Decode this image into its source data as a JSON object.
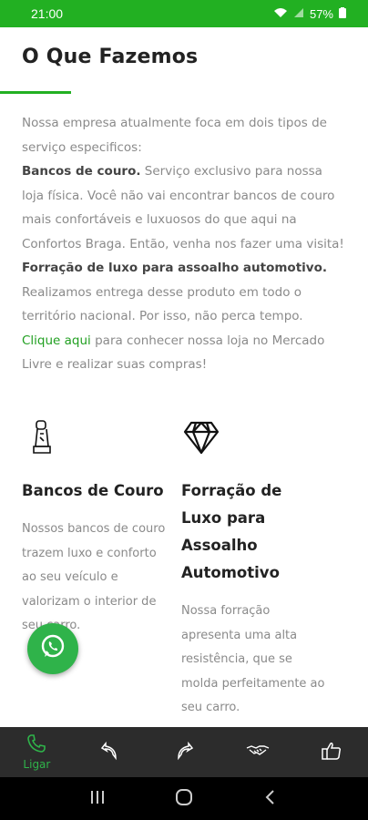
{
  "status": {
    "time": "21:00",
    "battery": "57%"
  },
  "section": {
    "title": "O Que Fazemos"
  },
  "intro": {
    "line1": "Nossa empresa atualmente foca em dois tipos de serviço especificos:",
    "item1_bold": "Bancos de couro.",
    "item1_text": " Serviço exclusivo para nossa loja física. Você não vai encontrar bancos de couro mais confortáveis e luxuosos do que aqui na Confortos Braga. Então, venha nos fazer uma visita!",
    "item2_bold": "Forração de luxo para assoalho automotivo.",
    "item2_text": " Realizamos entrega desse produto em todo o território nacional. Por isso, não perca tempo.",
    "link": "Clique aqui",
    "link_after": " para conhecer nossa loja no Mercado Livre e realizar suas compras!"
  },
  "services": [
    {
      "title": "Bancos de Couro",
      "text": "Nossos bancos de couro trazem luxo e conforto ao seu veículo e valorizam o interior de seu carro.",
      "icon": "seat-icon"
    },
    {
      "title": "Forração de Luxo para Assoalho Automotivo",
      "text": "Nossa forração apresenta uma alta resistência, que se molda perfeitamente ao seu carro.",
      "icon": "diamond-icon"
    }
  ],
  "toolbar": {
    "call_label": "Ligar"
  },
  "colors": {
    "accent": "#22b022",
    "toolbar_bg": "#2c2c2c",
    "whatsapp": "#2fb34a"
  }
}
